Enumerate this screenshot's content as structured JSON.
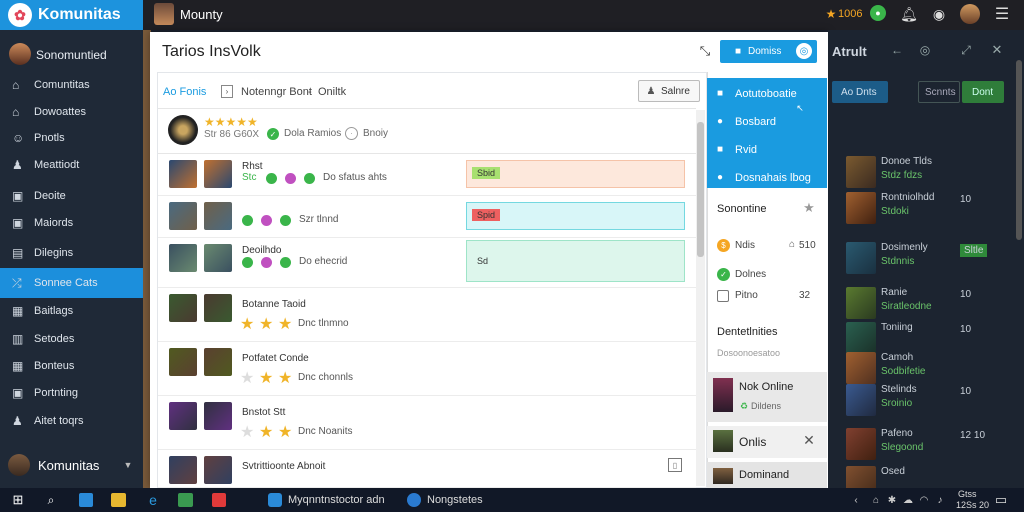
{
  "colors": {
    "accent": "#1a9be0",
    "sidebar": "#1e2836",
    "active": "#1c8fdc",
    "success": "#3ab54a",
    "danger": "#ee4c5c",
    "warning": "#f5a623"
  },
  "app": {
    "name": "Komunitas",
    "top_title": "Mounty",
    "points": "1006"
  },
  "sidebar": {
    "profile_name": "Sonomuntied",
    "bottom_name": "Komunitas",
    "items": [
      {
        "label": "Comuntitas",
        "icon": "home-icon"
      },
      {
        "label": "Dowoattes",
        "icon": "home-icon"
      },
      {
        "label": "Pnotls",
        "icon": "users-icon"
      },
      {
        "label": "Meattiodt",
        "icon": "person-icon"
      },
      {
        "label": "Deoite",
        "icon": "folder-icon"
      },
      {
        "label": "Maiords",
        "icon": "folder-icon"
      },
      {
        "label": "Dilegins",
        "icon": "chart-icon"
      },
      {
        "label": "Sonnee Cats",
        "icon": "shuffle-icon"
      },
      {
        "label": "Baitlags",
        "icon": "grid-icon"
      },
      {
        "label": "Setodes",
        "icon": "file-icon"
      },
      {
        "label": "Bonteus",
        "icon": "calendar-icon"
      },
      {
        "label": "Portnting",
        "icon": "folder-icon"
      },
      {
        "label": "Aitet toqrs",
        "icon": "person-icon"
      }
    ]
  },
  "modal": {
    "title": "Tarios InsVolk",
    "primary_button": "Domiss",
    "tab": "Ao Fonis",
    "breadcrumb": "Notenngr Bont",
    "breadcrumb_sep": "-",
    "breadcrumb_tail": "Oniltk",
    "action_button": "Salnre",
    "summary": {
      "stars": "★★★★★",
      "meta": "Str 86 G60X",
      "chip1": "Dola Ramios",
      "chip2": "Bnoiy"
    },
    "rows": [
      {
        "title": "Rhst",
        "sub": "Stc",
        "extra": "Do sfatus ahts",
        "bar": "Sbid",
        "bar_type": "peach"
      },
      {
        "title": "",
        "sub": "",
        "extra": "Szr tlnnd",
        "bar": "Spid",
        "bar_type": "cyan"
      },
      {
        "title": "Deoilhdo",
        "sub": "",
        "extra": "Do ehecrid",
        "bar": "Sd",
        "bar_type": "mint"
      },
      {
        "title": "Botanne Taoid",
        "sub": "",
        "extra": "Dnc tlnmno",
        "bar": "",
        "bar_type": ""
      },
      {
        "title": "Potfatet Conde",
        "sub": "",
        "extra": "Dnc chonnls",
        "bar": "",
        "bar_type": ""
      },
      {
        "title": "Bnstot Stt",
        "sub": "",
        "extra": "Dnc Noanits",
        "bar": "",
        "bar_type": ""
      },
      {
        "title": "Svtrittioonte Abnoit",
        "sub": "",
        "extra": "",
        "bar": "",
        "bar_type": ""
      }
    ]
  },
  "right_panel": {
    "menu": [
      "Aotutoboatie",
      "Bosbard",
      "Rvid",
      "Dosnahais lbog"
    ],
    "section1": "Sonontine",
    "list": [
      {
        "label": "Ndis",
        "val": "510"
      },
      {
        "label": "Dolnes",
        "val": ""
      },
      {
        "label": "Pitno",
        "val": "32"
      }
    ],
    "section2": "Dentetlnities",
    "section2_sub": "Dosoonoesatoo",
    "card1": {
      "title": "Nok Online",
      "sub": "Dildens"
    },
    "card2": {
      "title": "Onlis"
    },
    "card3": {
      "title": "Dominand"
    }
  },
  "far_right": {
    "title": "Atrult",
    "btn1": "Ao Dnts",
    "btn2": "Scnnts",
    "btn3": "Dont",
    "items": [
      {
        "title": "Donoe Tlds",
        "sub": "Stdz fdzs",
        "val": ""
      },
      {
        "title": "Rontniolhdd",
        "sub": "Stdoki",
        "val": "10"
      },
      {
        "title": "Dosimenly",
        "sub": "Stdnnis",
        "val": "Sltle"
      },
      {
        "title": "Ranie",
        "sub": "Siratleodne",
        "val": "10"
      },
      {
        "title": "Toniing",
        "sub": "",
        "val": "10"
      },
      {
        "title": "Camoh",
        "sub": "Sodbifetie",
        "val": ""
      },
      {
        "title": "Stelinds",
        "sub": "Sroinio",
        "val": "10"
      },
      {
        "title": "Pafeno",
        "sub": "Slegoond",
        "val": "12 10"
      },
      {
        "title": "Osed",
        "sub": "",
        "val": ""
      }
    ]
  },
  "taskbar": {
    "item1": "Myqnntnstoctor adn",
    "item2": "Nongstetes",
    "time": "Gtss",
    "date": "12Ss 20"
  }
}
